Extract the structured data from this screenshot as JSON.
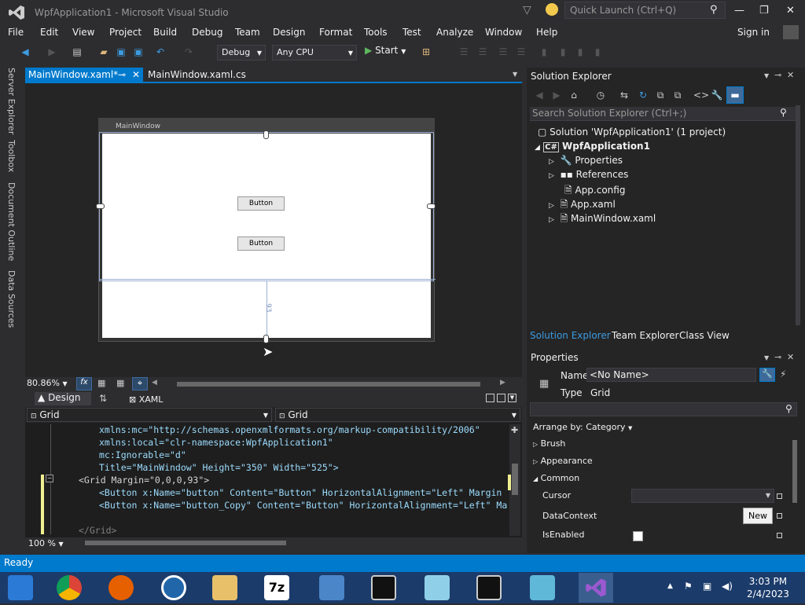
{
  "window": {
    "title": "WpfApplication1 - Microsoft Visual Studio",
    "quick_launch": "Quick Launch (Ctrl+Q)",
    "signin": "Sign in"
  },
  "menu": [
    "File",
    "Edit",
    "View",
    "Project",
    "Build",
    "Debug",
    "Team",
    "Design",
    "Format",
    "Tools",
    "Test",
    "Analyze",
    "Window",
    "Help"
  ],
  "toolbar": {
    "config": "Debug",
    "platform": "Any CPU",
    "start": "Start"
  },
  "side_tabs": [
    "Server Explorer",
    "Toolbox",
    "Document Outline",
    "Data Sources"
  ],
  "doc_tabs": {
    "active": "MainWindow.xaml*",
    "inactive": "MainWindow.xaml.cs"
  },
  "designer": {
    "window_title": "MainWindow",
    "button1": "Button",
    "button2": "Button",
    "margin_label": "93",
    "zoom": "80.86%"
  },
  "split": {
    "design": "Design",
    "xaml": "XAML"
  },
  "breadcrumbs": {
    "left": "Grid",
    "right": "Grid"
  },
  "code_lines": [
    "xmlns:mc=\"http://schemas.openxmlformats.org/markup-compatibility/2006\"",
    "xmlns:local=\"clr-namespace:WpfApplication1\"",
    "mc:Ignorable=\"d\"",
    "Title=\"MainWindow\" Height=\"350\" Width=\"525\">",
    "<Grid Margin=\"0,0,0,93\">",
    "<Button x:Name=\"button\" Content=\"Button\" HorizontalAlignment=\"Left\" Margin",
    "<Button x:Name=\"button_Copy\" Content=\"Button\" HorizontalAlignment=\"Left\" Ma",
    "</Grid>"
  ],
  "editor_zoom": "100 %",
  "solution_explorer": {
    "title": "Solution Explorer",
    "search": "Search Solution Explorer (Ctrl+;)",
    "items": [
      "Solution 'WpfApplication1' (1 project)",
      "WpfApplication1",
      "Properties",
      "References",
      "App.config",
      "App.xaml",
      "MainWindow.xaml"
    ],
    "bottom_tabs": [
      "Solution Explorer",
      "Team Explorer",
      "Class View"
    ]
  },
  "properties": {
    "title": "Properties",
    "name_label": "Name",
    "name_value": "<No Name>",
    "type_label": "Type",
    "type_value": "Grid",
    "arrange": "Arrange by: Category",
    "categories": [
      "Brush",
      "Appearance",
      "Common"
    ],
    "rows": [
      "Cursor",
      "DataContext",
      "IsEnabled"
    ],
    "new_button": "New"
  },
  "status": "Ready",
  "clock": {
    "time": "3:03 PM",
    "date": "2/4/2023"
  },
  "colors": {
    "accent": "#007acc",
    "vs_purple": "#68217a",
    "bg": "#2d2d30"
  }
}
